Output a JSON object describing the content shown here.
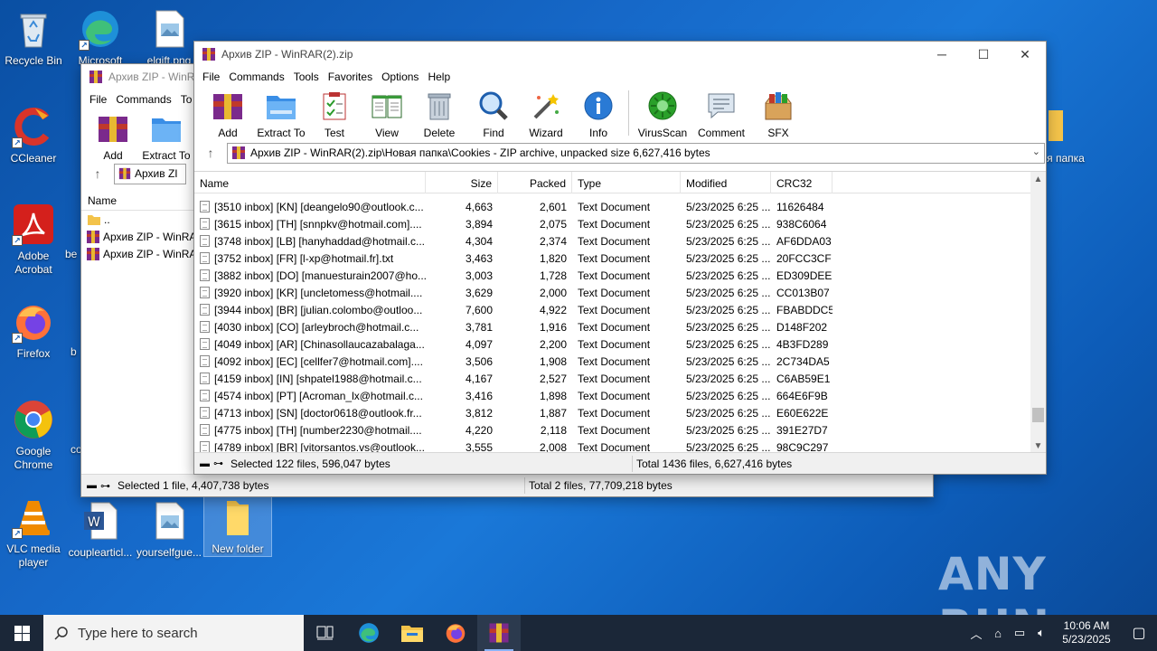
{
  "desktop": {
    "icons": [
      {
        "label": "Recycle Bin",
        "icon": "recycle-bin-icon"
      },
      {
        "label": "Microsoft",
        "icon": "edge-icon"
      },
      {
        "label": "elgift.png",
        "icon": "image-file-icon"
      },
      {
        "label": "CCleaner",
        "icon": "ccleaner-icon"
      },
      {
        "label": "Adobe Acrobat",
        "icon": "acrobat-icon"
      },
      {
        "label": "Firefox",
        "icon": "firefox-icon"
      },
      {
        "label": "Google Chrome",
        "icon": "chrome-icon"
      },
      {
        "label": "VLC media player",
        "icon": "vlc-icon"
      },
      {
        "label": "couplearticl...",
        "icon": "word-doc-icon"
      },
      {
        "label": "yourselfgue...",
        "icon": "image-file-icon"
      },
      {
        "label": "New folder",
        "icon": "folder-icon"
      },
      {
        "label": "я папка",
        "icon": "folder-icon"
      },
      {
        "label": "be",
        "icon": ""
      },
      {
        "label": "b",
        "icon": ""
      },
      {
        "label": "co",
        "icon": ""
      }
    ],
    "watermark": "ANY RUN"
  },
  "back_window": {
    "title": "Архив ZIP - WinRAR",
    "menu": [
      "File",
      "Commands",
      "To"
    ],
    "toolbar": [
      "Add",
      "Extract To"
    ],
    "address": "Архив ZI",
    "column_name": "Name",
    "items": [
      "..",
      "Архив ZIP - WinRA",
      "Архив ZIP - WinRA"
    ],
    "status_left": "Selected 1 file, 4,407,738 bytes",
    "status_right": "Total 2 files, 77,709,218 bytes"
  },
  "front_window": {
    "title": "Архив ZIP - WinRAR(2).zip",
    "menu": [
      "File",
      "Commands",
      "Tools",
      "Favorites",
      "Options",
      "Help"
    ],
    "toolbar": [
      {
        "label": "Add",
        "icon": "add-archive-icon"
      },
      {
        "label": "Extract To",
        "icon": "extract-folder-icon"
      },
      {
        "label": "Test",
        "icon": "test-clipboard-icon"
      },
      {
        "label": "View",
        "icon": "view-book-icon"
      },
      {
        "label": "Delete",
        "icon": "trash-icon"
      },
      {
        "label": "Find",
        "icon": "magnifier-icon"
      },
      {
        "label": "Wizard",
        "icon": "wizard-wand-icon"
      },
      {
        "label": "Info",
        "icon": "info-icon"
      },
      {
        "label": "VirusScan",
        "icon": "virus-scan-icon"
      },
      {
        "label": "Comment",
        "icon": "comment-icon"
      },
      {
        "label": "SFX",
        "icon": "sfx-box-icon"
      }
    ],
    "address": "Архив ZIP - WinRAR(2).zip\\Новая папка\\Cookies - ZIP archive, unpacked size 6,627,416 bytes",
    "columns": [
      "Name",
      "Size",
      "Packed",
      "Type",
      "Modified",
      "CRC32"
    ],
    "rows": [
      [
        "[3510 inbox] [KN] [deangelo90@outlook.c...",
        "4,663",
        "2,601",
        "Text Document",
        "5/23/2025 6:25 ...",
        "11626484"
      ],
      [
        "[3615 inbox] [TH] [snnpkv@hotmail.com]....",
        "3,894",
        "2,075",
        "Text Document",
        "5/23/2025 6:25 ...",
        "938C6064"
      ],
      [
        "[3748 inbox] [LB] [hanyhaddad@hotmail.c...",
        "4,304",
        "2,374",
        "Text Document",
        "5/23/2025 6:25 ...",
        "AF6DDA03"
      ],
      [
        "[3752 inbox] [FR] [l-xp@hotmail.fr].txt",
        "3,463",
        "1,820",
        "Text Document",
        "5/23/2025 6:25 ...",
        "20FCC3CF"
      ],
      [
        "[3882 inbox] [DO] [manuesturain2007@ho...",
        "3,003",
        "1,728",
        "Text Document",
        "5/23/2025 6:25 ...",
        "ED309DEE"
      ],
      [
        "[3920 inbox] [KR] [uncletomess@hotmail....",
        "3,629",
        "2,000",
        "Text Document",
        "5/23/2025 6:25 ...",
        "CC013B07"
      ],
      [
        "[3944 inbox] [BR] [julian.colombo@outloo...",
        "7,600",
        "4,922",
        "Text Document",
        "5/23/2025 6:25 ...",
        "FBABDDC5"
      ],
      [
        "[4030 inbox] [CO] [arleybroch@hotmail.c...",
        "3,781",
        "1,916",
        "Text Document",
        "5/23/2025 6:25 ...",
        "D148F202"
      ],
      [
        "[4049 inbox] [AR] [Chinasollaucazabalaga...",
        "4,097",
        "2,200",
        "Text Document",
        "5/23/2025 6:25 ...",
        "4B3FD289"
      ],
      [
        "[4092 inbox] [EC] [cellfer7@hotmail.com]....",
        "3,506",
        "1,908",
        "Text Document",
        "5/23/2025 6:25 ...",
        "2C734DA5"
      ],
      [
        "[4159 inbox] [IN] [shpatel1988@hotmail.c...",
        "4,167",
        "2,527",
        "Text Document",
        "5/23/2025 6:25 ...",
        "C6AB59E1"
      ],
      [
        "[4574 inbox] [PT] [Acroman_lx@hotmail.c...",
        "3,416",
        "1,898",
        "Text Document",
        "5/23/2025 6:25 ...",
        "664E6F9B"
      ],
      [
        "[4713 inbox] [SN] [doctor0618@outlook.fr...",
        "3,812",
        "1,887",
        "Text Document",
        "5/23/2025 6:25 ...",
        "E60E622E"
      ],
      [
        "[4775 inbox] [TH] [number2230@hotmail....",
        "4,220",
        "2,118",
        "Text Document",
        "5/23/2025 6:25 ...",
        "391E27D7"
      ],
      [
        "[4789 inbox] [BR] [vitorsantos.vs@outlook...",
        "3,555",
        "2,008",
        "Text Document",
        "5/23/2025 6:25 ...",
        "98C9C297"
      ]
    ],
    "status_left": "Selected 122 files, 596,047 bytes",
    "status_right": "Total 1436 files, 6,627,416 bytes",
    "scroll_position": 0.93
  },
  "taskbar": {
    "search_placeholder": "Type here to search",
    "apps": [
      "task-view-icon",
      "edge-icon",
      "file-explorer-icon",
      "firefox-icon",
      "winrar-icon"
    ],
    "time": "10:06 AM",
    "date": "5/23/2025"
  },
  "colors": {
    "desktop_bg": "#1668c8",
    "taskbar_bg": "#1b2738",
    "winrar_red": "#c0392b",
    "accent_blue": "#2a7ad5"
  }
}
